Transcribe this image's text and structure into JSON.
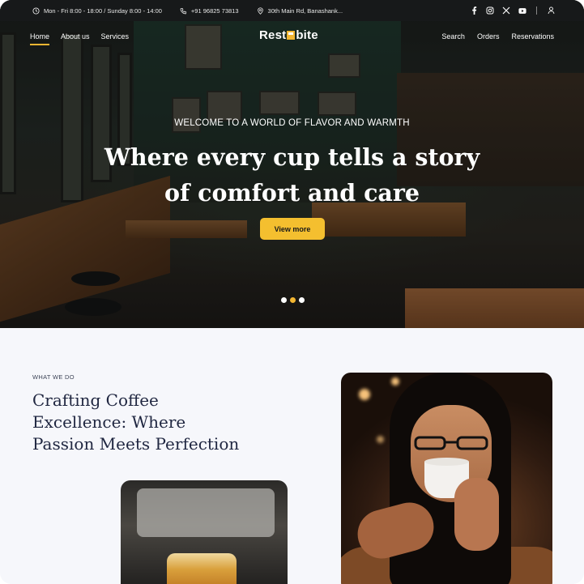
{
  "topbar": {
    "hours": "Mon - Fri 8:00 - 18:00 / Sunday 8:00 - 14:00",
    "phone": "+91 96825 73813",
    "address": "30th Main Rd, Banashank..."
  },
  "nav": {
    "left": [
      "Home",
      "About us",
      "Services"
    ],
    "right": [
      "Search",
      "Orders",
      "Reservations"
    ],
    "logo_left": "Rest",
    "logo_right": "bite"
  },
  "hero": {
    "eyebrow": "WELCOME TO A WORLD OF FLAVOR AND WARMTH",
    "headline_line1": "Where every cup tells a story",
    "headline_line2": "of comfort and care",
    "cta": "View more",
    "active_slide": 2,
    "slide_count": 3
  },
  "section": {
    "eyebrow": "WHAT WE DO",
    "title_line1": "Crafting Coffee",
    "title_line2": "Excellence: Where",
    "title_line3": "Passion Meets Perfection"
  },
  "colors": {
    "accent": "#f4bf2f",
    "topbar": "#17191a",
    "page_bg": "#f6f7fb",
    "title": "#1f2640"
  },
  "icons": [
    "clock-icon",
    "phone-icon",
    "location-icon",
    "facebook-icon",
    "instagram-icon",
    "x-icon",
    "youtube-icon",
    "user-icon"
  ]
}
